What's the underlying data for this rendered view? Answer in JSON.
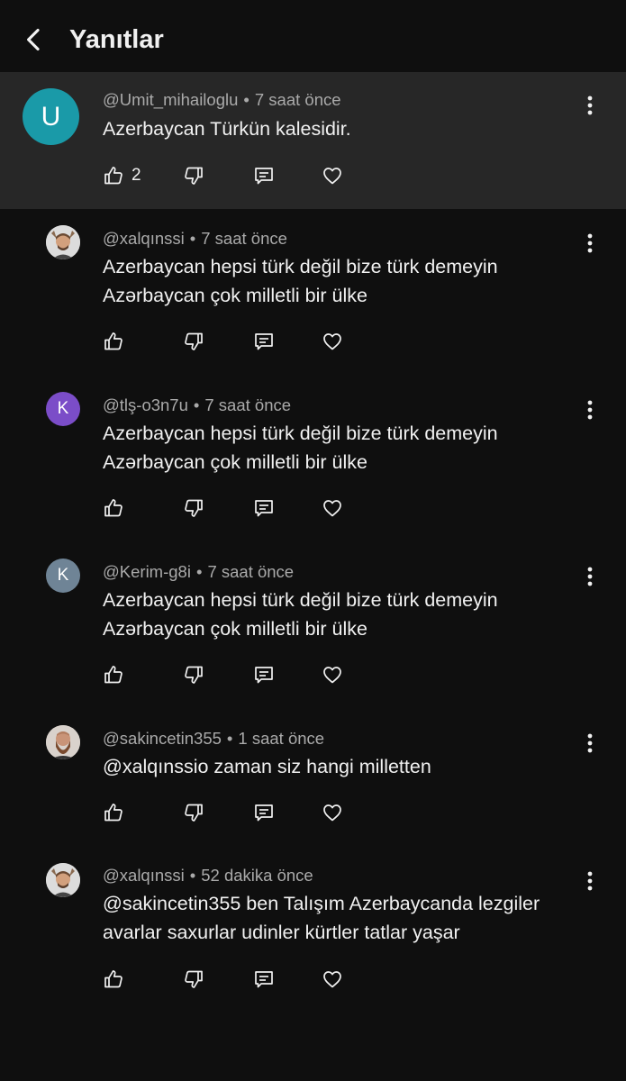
{
  "header": {
    "title": "Yanıtlar"
  },
  "comments": [
    {
      "author": "@Umit_mihailoglu",
      "time": "7 saat önce",
      "lines": [
        "Azerbaycan Türkün kalesidir."
      ],
      "likes": "2",
      "avatar_letter": "U",
      "avatar_color": "#1a9aa8"
    },
    {
      "author": "@xalqınssi",
      "time": "7 saat önce",
      "lines": [
        "Azerbaycan hepsi türk değil bize türk demeyin",
        "Azərbaycan çok milletli bir ülke"
      ],
      "likes": "",
      "avatar_letter": "",
      "avatar_color": "#dcdcdc"
    },
    {
      "author": "@tlş-o3n7u",
      "time": "7 saat önce",
      "lines": [
        "Azerbaycan hepsi türk değil bize türk demeyin",
        "Azərbaycan çok milletli bir ülke"
      ],
      "likes": "",
      "avatar_letter": "K",
      "avatar_color": "#7b4dc8"
    },
    {
      "author": "@Kerim-g8i",
      "time": "7 saat önce",
      "lines": [
        "Azerbaycan hepsi türk değil bize türk demeyin",
        "Azərbaycan çok milletli bir ülke"
      ],
      "likes": "",
      "avatar_letter": "K",
      "avatar_color": "#6f8496"
    },
    {
      "author": "@sakincetin355",
      "time": "1 saat önce",
      "lines": [
        "@xalqınssio zaman siz hangi milletten"
      ],
      "likes": "",
      "avatar_letter": "",
      "avatar_color": "#d9d2cc"
    },
    {
      "author": "@xalqınssi",
      "time": "52 dakika önce",
      "lines": [
        "@sakincetin355 ben Talışım Azerbaycanda lezgiler",
        "avarlar saxurlar udinler kürtler tatlar yaşar"
      ],
      "likes": "",
      "avatar_letter": "",
      "avatar_color": "#dcdcdc"
    }
  ],
  "icons": {
    "back": "chevron-left-icon",
    "like": "thumb-up-icon",
    "dislike": "thumb-down-icon",
    "reply": "reply-icon",
    "heart": "heart-icon",
    "more": "more-vertical-icon"
  },
  "colors": {
    "background": "#0f0f0f",
    "highlight": "#272727",
    "secondary_text": "#aaaaaa"
  }
}
